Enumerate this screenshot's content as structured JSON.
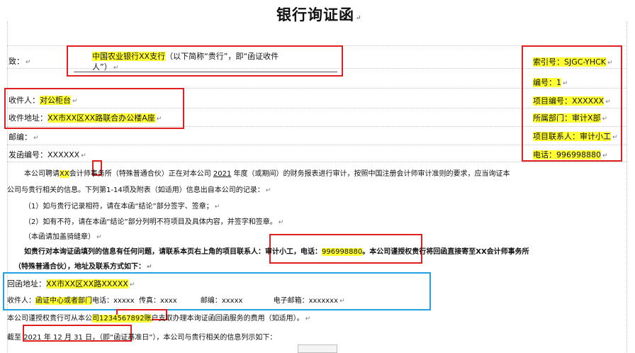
{
  "title": "银行询证函",
  "to_label": "致：",
  "to_text_line1_hl": "中国农业银行XX支行",
  "to_text_line1_rest": "（以下简称“贵行”，即“函证收件",
  "to_text_line2": "人”）",
  "recipient_label": "收件人：",
  "recipient_value": "对公柜台",
  "address_label": "收件地址：",
  "address_value": "XX市XX区XX路联合办公楼A座",
  "postcode_label": "邮编：",
  "letter_no_label": "发函编号：",
  "letter_no_value": "XXXXXX",
  "index_no": "索引号：SJGC-YHCK",
  "serial_no": "编号：1",
  "project_no": "项目编号：XXXXXX",
  "department": "所属部门：审计X部",
  "contact": "项目联系人：审计小工",
  "phone": "电话：996998880",
  "para1_a": "本公司聘请",
  "para1_xx": "XX",
  "para1_b": "会计师事务所（特殊普通合伙）正在对本公司",
  "para1_year": "2021",
  "para1_c": "年度（或期间）的财务报表进行审计，按照中国注册会计师审计准则的要求，应当询证本",
  "para1_line2": "公司与贵行相关的信息。下列第1-14项及附表（如适用）信息出自本公司的记录：",
  "item1": "（1）如与贵行记录相符，请在本函“结论”部分签字、签章；",
  "item2": "（2）如有不符，请在本函“结论”部分列明不符项目及具体内容，并签字和签章。",
  "item3": "（本函请加盖骑缝章）",
  "bold_a": "如贵行对本询证函填列的信息有任何问题，请联系本页右上角的项目",
  "bold_contact": "联系人：审计小工，电话：",
  "bold_phone": "996998880",
  "bold_b": "。本公司谨授权贵行将回函直接寄至XX会计师事务所",
  "bold_line2": "（特殊普通合伙），地址及联系方式如下：",
  "reply_addr_label": "回函地址：",
  "reply_addr_value": "XX市XX区XX路XXXXX",
  "reply_recipient_label": "收件人：",
  "reply_recipient_value": "函证中心或者部门",
  "reply_phone": "电话：xxxxx",
  "reply_fax": "传真：xxxx",
  "reply_post": "邮编：",
  "reply_post_value": "xxxxx",
  "reply_email": "电子邮箱：",
  "reply_email_value": "xxxxxxx",
  "auth_a": "本公司谨授权贵行可从本公",
  "auth_acct": "司1234567892账",
  "auth_b": "户支取办理本询证函回函服务的费用（如适用）。",
  "cutoff_label": "截至",
  "cutoff_year": "2021",
  "cutoff_y": "年",
  "cutoff_month": "12",
  "cutoff_m": "月",
  "cutoff_day": "31",
  "cutoff_d": "日，",
  "cutoff_rest": "（即“函证基准日”），本公司与贵行相关的信息列示如下：",
  "para_mark": "↵"
}
